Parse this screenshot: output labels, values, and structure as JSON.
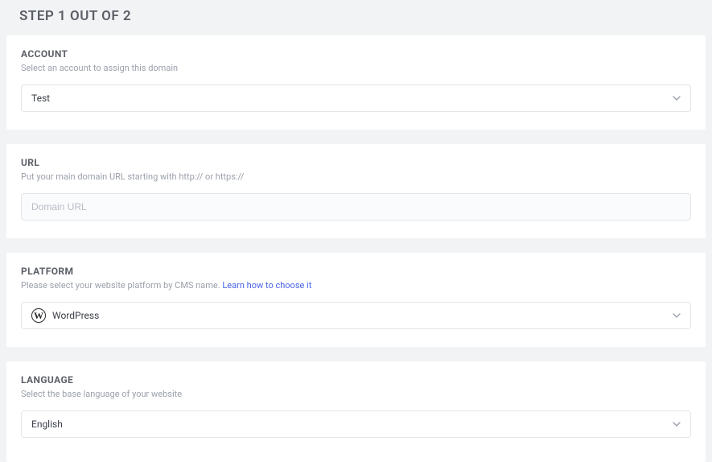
{
  "page": {
    "title": "STEP 1 OUT OF 2"
  },
  "account": {
    "title": "ACCOUNT",
    "desc": "Select an account to assign this domain",
    "selected": "Test"
  },
  "url": {
    "title": "URL",
    "desc": "Put your main domain URL starting with http:// or https://",
    "placeholder": "Domain URL"
  },
  "platform": {
    "title": "PLATFORM",
    "desc_prefix": "Please select your website platform by CMS name.  ",
    "link_text": "Learn how to choose it",
    "selected": "WordPress",
    "icon_glyph": "W"
  },
  "language": {
    "title": "LANGUAGE",
    "desc": "Select the base language of your website",
    "selected": "English"
  }
}
